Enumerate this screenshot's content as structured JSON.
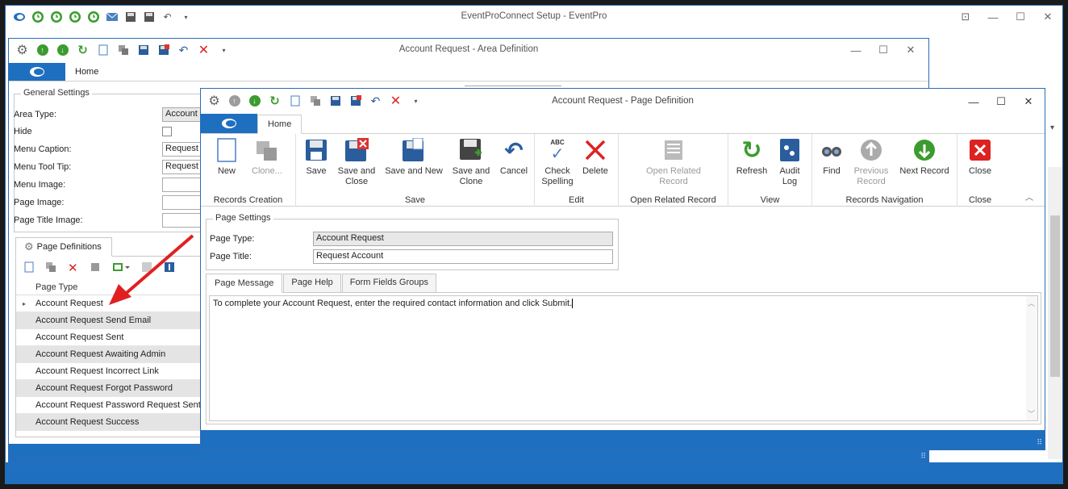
{
  "main_window": {
    "title": "EventProConnect Setup - EventPro"
  },
  "area_window": {
    "title": "Account Request - Area Definition",
    "home_tab": "Home",
    "general_settings": {
      "title": "General Settings",
      "fields": [
        {
          "label": "Area Type:",
          "value": "Account"
        },
        {
          "label": "Hide",
          "value": ""
        },
        {
          "label": "Menu Caption:",
          "value": "Request"
        },
        {
          "label": "Menu Tool Tip:",
          "value": "Request"
        },
        {
          "label": "Menu Image:",
          "value": ""
        },
        {
          "label": "Page Image:",
          "value": ""
        },
        {
          "label": "Page Title Image:",
          "value": ""
        }
      ]
    },
    "page_definitions_tab": "Page Definitions",
    "grid_header": "Page Type",
    "rows": [
      "Account Request",
      "Account Request Send Email",
      "Account Request Sent",
      "Account Request Awaiting Admin",
      "Account Request Incorrect Link",
      "Account Request Forgot Password",
      "Account Request Password Request Sent",
      "Account Request Success"
    ]
  },
  "page_window": {
    "title": "Account Request - Page Definition",
    "home_tab": "Home",
    "ribbon": {
      "records_creation": {
        "label": "Records Creation",
        "new": "New",
        "clone": "Clone..."
      },
      "save": {
        "label": "Save",
        "save": "Save",
        "save_close_1": "Save and",
        "save_close_2": "Close",
        "save_new": "Save and New",
        "save_clone_1": "Save and",
        "save_clone_2": "Clone",
        "cancel": "Cancel"
      },
      "edit": {
        "label": "Edit",
        "check_1": "Check",
        "check_2": "Spelling",
        "delete": "Delete",
        "abc": "ABC"
      },
      "related": {
        "label": "Open Related Record",
        "open_1": "Open Related",
        "open_2": "Record"
      },
      "view": {
        "label": "View",
        "refresh": "Refresh",
        "audit_1": "Audit",
        "audit_2": "Log"
      },
      "navigation": {
        "label": "Records Navigation",
        "find": "Find",
        "prev_1": "Previous",
        "prev_2": "Record",
        "next": "Next Record"
      },
      "close": {
        "label": "Close",
        "close": "Close"
      }
    },
    "page_settings": {
      "title": "Page Settings",
      "page_type_label": "Page Type:",
      "page_type_value": "Account Request",
      "page_title_label": "Page Title:",
      "page_title_value": "Request Account"
    },
    "tabs": [
      "Page Message",
      "Page Help",
      "Form Fields Groups"
    ],
    "message_text": "To complete your Account Request, enter the required contact information and click Submit."
  },
  "colors": {
    "accent": "#1f6fc0",
    "arrow": "#e02020"
  }
}
